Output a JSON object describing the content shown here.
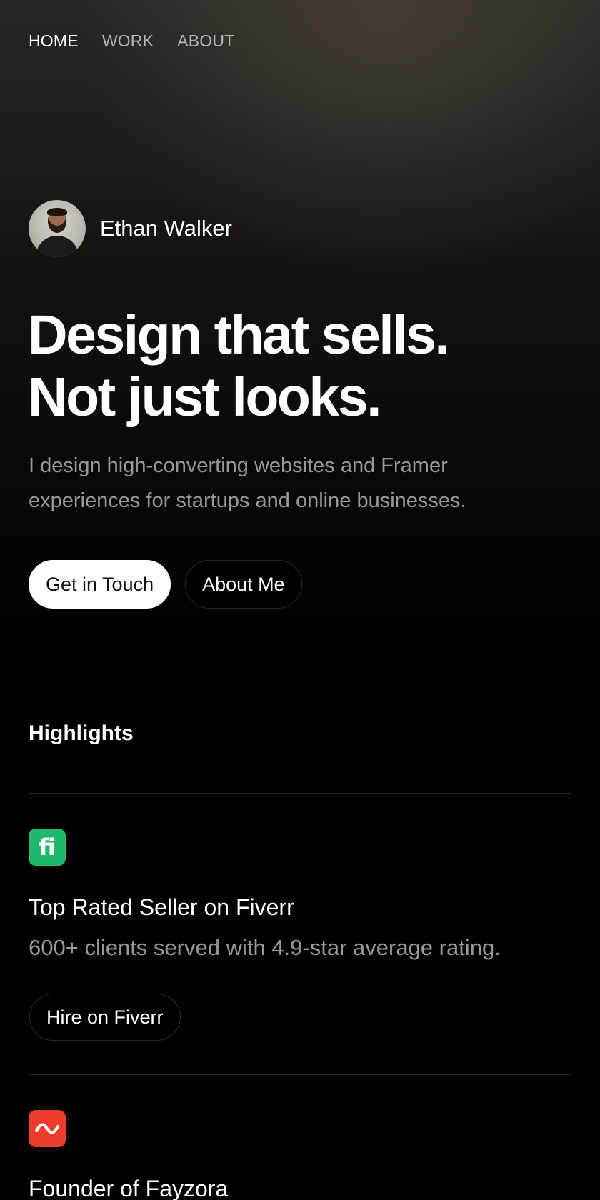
{
  "nav": {
    "items": [
      {
        "label": "HOME",
        "active": true
      },
      {
        "label": "WORK",
        "active": false
      },
      {
        "label": "ABOUT",
        "active": false
      }
    ]
  },
  "profile": {
    "name": "Ethan Walker"
  },
  "hero": {
    "headline_line1": "Design that sells.",
    "headline_line2": "Not just looks.",
    "subtitle_line1": "I design high-converting websites and Framer",
    "subtitle_line2": "experiences for startups and online businesses.",
    "primary_button": "Get in Touch",
    "secondary_button": "About Me"
  },
  "highlights": {
    "title": "Highlights",
    "items": [
      {
        "icon": "fiverr-icon",
        "icon_glyph": "fi",
        "icon_color": "#21b96c",
        "title": "Top Rated Seller on Fiverr",
        "description": "600+ clients served with 4.9-star average rating.",
        "button": "Hire on Fiverr"
      },
      {
        "icon": "fayzora-icon",
        "icon_color": "#ee3b2b",
        "title": "Founder of Fayzora"
      }
    ]
  }
}
